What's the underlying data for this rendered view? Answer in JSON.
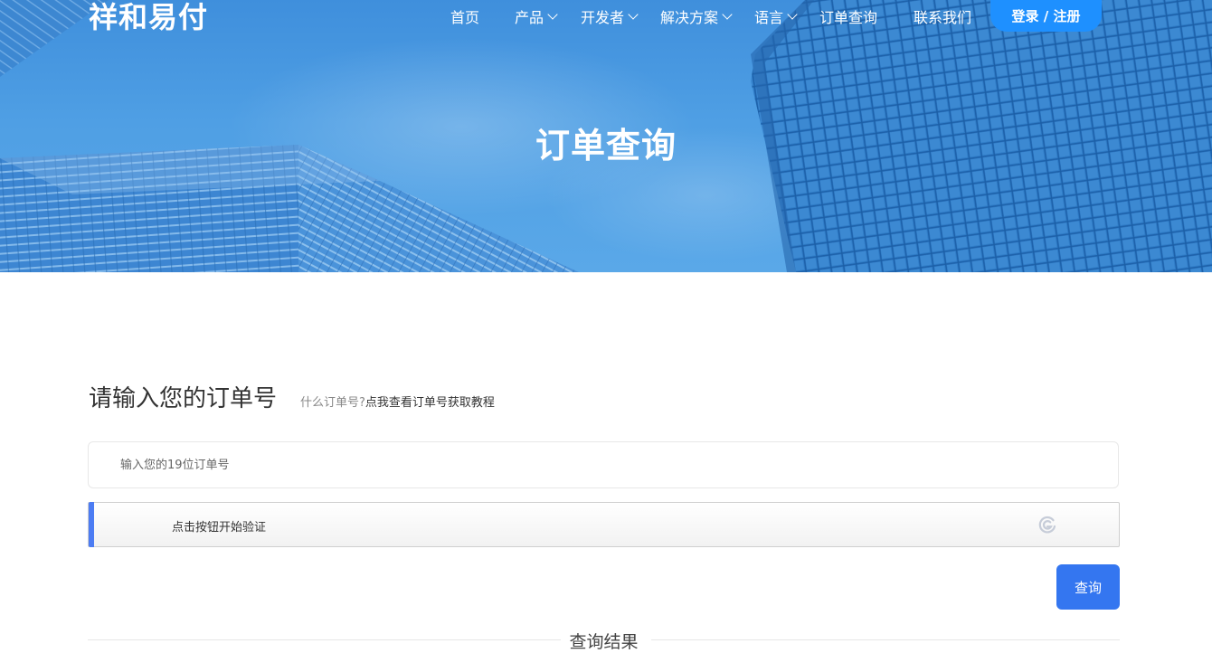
{
  "brand": {
    "logo_text": "祥和易付"
  },
  "nav": {
    "items": [
      {
        "label": "首页",
        "has_dropdown": false
      },
      {
        "label": "产品",
        "has_dropdown": true
      },
      {
        "label": "开发者",
        "has_dropdown": true
      },
      {
        "label": "解决方案",
        "has_dropdown": true
      },
      {
        "label": "语言",
        "has_dropdown": true
      },
      {
        "label": "订单查询",
        "has_dropdown": false
      },
      {
        "label": "联系我们",
        "has_dropdown": false
      }
    ],
    "login_label": "登录 / 注册"
  },
  "hero": {
    "title": "订单查询"
  },
  "form": {
    "title": "请输入您的订单号",
    "hint_prefix": "什么订单号?",
    "hint_link": "点我查看订单号获取教程",
    "order_input": {
      "placeholder": "输入您的19位订单号",
      "value": ""
    },
    "captcha_label": "点击按钮开始验证",
    "submit_label": "查询",
    "result_label": "查询结果"
  },
  "colors": {
    "accent": "#3476f0",
    "login_button": "#1e90ff",
    "captcha_bar": "#4c7cf3",
    "hero_blue": "#4f9fe4"
  }
}
